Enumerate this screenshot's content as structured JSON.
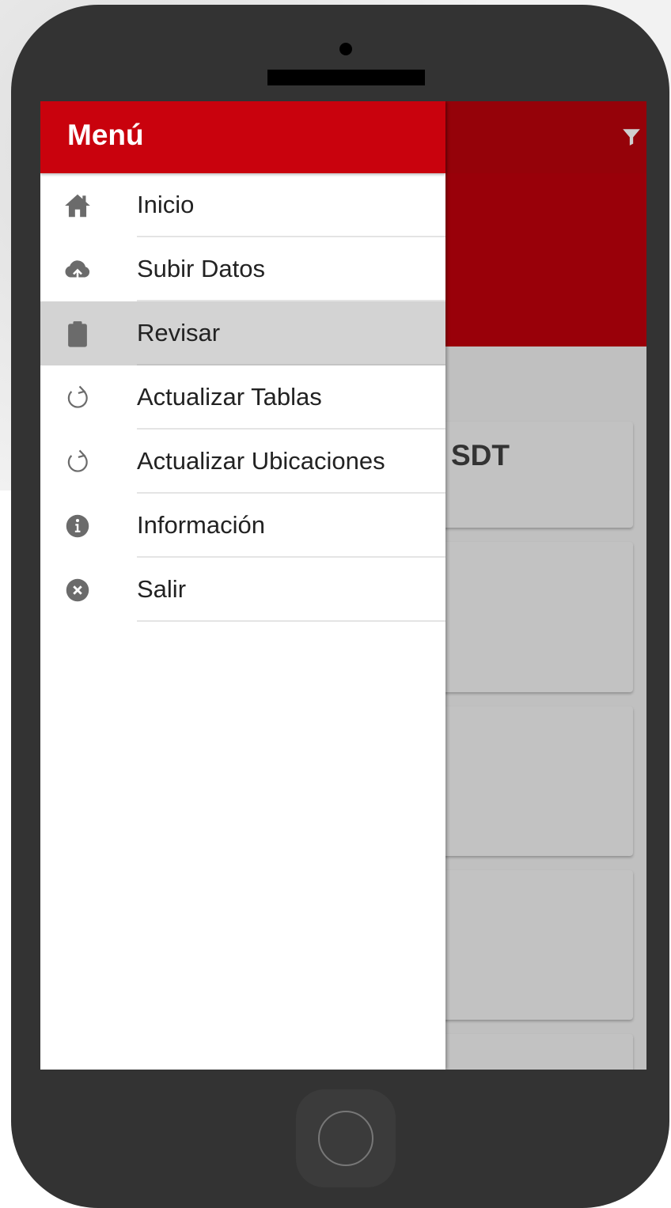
{
  "drawer": {
    "title": "Menú",
    "items": [
      {
        "label": "Inicio",
        "icon": "home-icon",
        "active": false
      },
      {
        "label": "Subir Datos",
        "icon": "cloud-upload-icon",
        "active": false
      },
      {
        "label": "Revisar",
        "icon": "clipboard-icon",
        "active": true
      },
      {
        "label": "Actualizar Tablas",
        "icon": "refresh-icon",
        "active": false
      },
      {
        "label": "Actualizar Ubicaciones",
        "icon": "refresh-icon",
        "active": false
      },
      {
        "label": "Información",
        "icon": "info-icon",
        "active": false
      },
      {
        "label": "Salir",
        "icon": "close-circle-icon",
        "active": false
      }
    ]
  },
  "background_app": {
    "card_title": "SDT",
    "toolbar_icon": "filter-icon"
  },
  "colors": {
    "drawer_header": "#c9020d",
    "app_toolbar": "#950209",
    "icon_gray": "#6b6b6b",
    "active_item_bg": "#d3d3d3"
  }
}
